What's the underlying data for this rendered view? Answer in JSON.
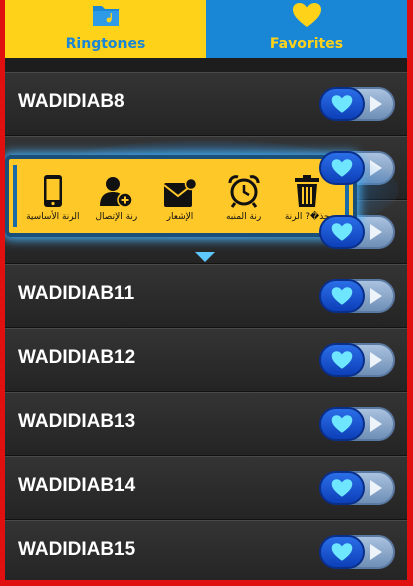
{
  "tabs": [
    {
      "label": "Ringtones",
      "icon": "folder-music-icon",
      "active": true
    },
    {
      "label": "Favorites",
      "icon": "heart-icon",
      "active": false
    }
  ],
  "popup": {
    "items": [
      {
        "label": "الرنة الأساسية",
        "icon": "phone-icon"
      },
      {
        "label": "رنة الإتصال",
        "icon": "contact-add-icon"
      },
      {
        "label": "الإشعار",
        "icon": "notification-envelope-icon"
      },
      {
        "label": "رنة المنبه",
        "icon": "alarm-clock-icon"
      },
      {
        "label": "حذ�? الرنة",
        "icon": "trash-icon"
      }
    ]
  },
  "rows": [
    {
      "title": "WADIDIAB8"
    },
    {
      "title": ""
    },
    {
      "title": ""
    },
    {
      "title": "WADIDIAB11"
    },
    {
      "title": "WADIDIAB12"
    },
    {
      "title": "WADIDIAB13"
    },
    {
      "title": "WADIDIAB14"
    },
    {
      "title": "WADIDIAB15"
    }
  ],
  "colors": {
    "tab_active_bg": "#ffd21a",
    "tab_inactive_bg": "#1a86d6",
    "frame_border": "#e01010",
    "favorite_button": "#1a50d0",
    "heart": "#6fe6ff",
    "popup_bg": "#ffc829"
  }
}
